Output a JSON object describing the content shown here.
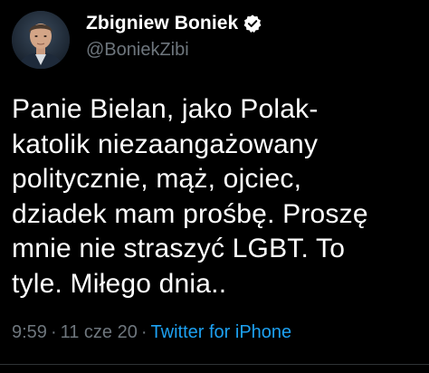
{
  "author": {
    "display_name": "Zbigniew Boniek",
    "handle": "@BoniekZibi",
    "verified": true
  },
  "tweet": {
    "text": "Panie Bielan, jako Polak-\nkatolik niezaangażowany\npolitycznie, mąż, ojciec,\ndziadek mam prośbę. Proszę\nmnie nie straszyć LGBT. To\ntyle. Miłego dnia..",
    "time": "9:59",
    "date": "11 cze 20",
    "separator": "·",
    "source": "Twitter for iPhone"
  },
  "colors": {
    "background": "#000000",
    "text_primary": "#ffffff",
    "text_secondary": "#6e767d",
    "accent": "#1da1f2"
  },
  "icons": {
    "verified": "verified-badge-icon",
    "avatar": "profile-photo"
  }
}
